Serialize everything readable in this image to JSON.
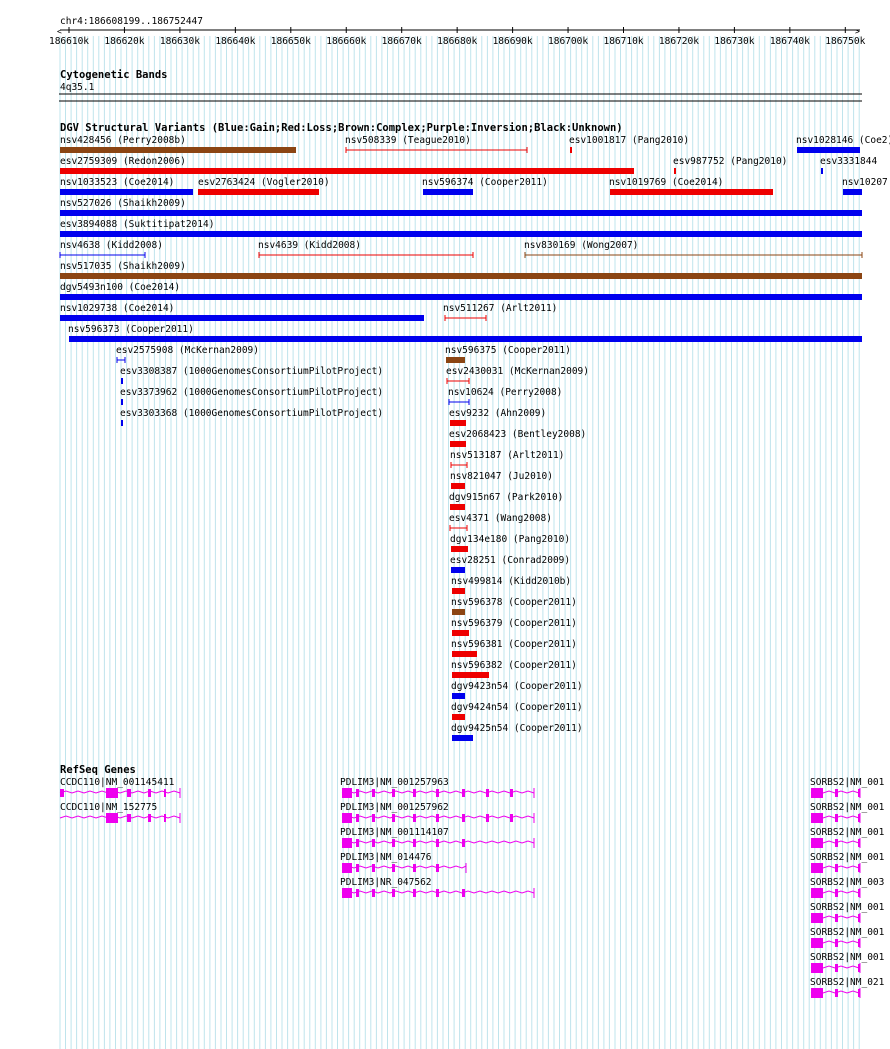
{
  "position_label": "chr4:186608199..186752447",
  "ruler": {
    "ticks": [
      "186610k",
      "186620k",
      "186630k",
      "186640k",
      "186650k",
      "186660k",
      "186670k",
      "186680k",
      "186690k",
      "186700k",
      "186710k",
      "186720k",
      "186730k",
      "186740k",
      "186750k"
    ]
  },
  "cyto": {
    "title": "Cytogenetic Bands",
    "band": "4q35.1"
  },
  "dgv": {
    "title": "DGV Structural Variants (Blue:Gain;Red:Loss;Brown:Complex;Purple:Inversion;Black:Unknown)",
    "colors": {
      "gain": "#0000ee",
      "loss": "#ee0000",
      "complex": "#8b4513"
    },
    "items": [
      {
        "id": "nsv428456",
        "study": "Perry2008b",
        "type": "complex"
      },
      {
        "id": "nsv508339",
        "study": "Teague2010",
        "type": "loss"
      },
      {
        "id": "esv1001817",
        "study": "Pang2010",
        "type": "loss"
      },
      {
        "id": "nsv1028146",
        "study": "Coe2",
        "type": "gain"
      },
      {
        "id": "esv2759309",
        "study": "Redon2006",
        "type": "loss"
      },
      {
        "id": "esv987752",
        "study": "Pang2010",
        "type": "loss"
      },
      {
        "id": "esv3331844",
        "study": "",
        "type": "gain"
      },
      {
        "id": "nsv1033523",
        "study": "Coe2014",
        "type": "gain"
      },
      {
        "id": "esv2763424",
        "study": "Vogler2010",
        "type": "loss"
      },
      {
        "id": "nsv596374",
        "study": "Cooper2011",
        "type": "gain"
      },
      {
        "id": "nsv1019769",
        "study": "Coe2014",
        "type": "loss"
      },
      {
        "id": "nsv10207",
        "study": "",
        "type": "gain"
      },
      {
        "id": "nsv527026",
        "study": "Shaikh2009",
        "type": "gain"
      },
      {
        "id": "esv3894088",
        "study": "Suktitipat2014",
        "type": "gain"
      },
      {
        "id": "nsv4638",
        "study": "Kidd2008",
        "type": "gain"
      },
      {
        "id": "nsv4639",
        "study": "Kidd2008",
        "type": "loss"
      },
      {
        "id": "nsv830169",
        "study": "Wong2007",
        "type": "complex"
      },
      {
        "id": "nsv517035",
        "study": "Shaikh2009",
        "type": "complex"
      },
      {
        "id": "dgv5493n100",
        "study": "Coe2014",
        "type": "gain"
      },
      {
        "id": "nsv1029738",
        "study": "Coe2014",
        "type": "gain"
      },
      {
        "id": "nsv511267",
        "study": "Arlt2011",
        "type": "loss"
      },
      {
        "id": "nsv596373",
        "study": "Cooper2011",
        "type": "gain"
      },
      {
        "id": "esv2575908",
        "study": "McKernan2009",
        "type": "gain"
      },
      {
        "id": "nsv596375",
        "study": "Cooper2011",
        "type": "complex"
      },
      {
        "id": "esv3308387",
        "study": "1000GenomesConsortiumPilotProject",
        "type": "gain"
      },
      {
        "id": "esv2430031",
        "study": "McKernan2009",
        "type": "loss"
      },
      {
        "id": "esv3373962",
        "study": "1000GenomesConsortiumPilotProject",
        "type": "gain"
      },
      {
        "id": "nsv10624",
        "study": "Perry2008",
        "type": "gain"
      },
      {
        "id": "esv3303368",
        "study": "1000GenomesConsortiumPilotProject",
        "type": "gain"
      },
      {
        "id": "esv9232",
        "study": "Ahn2009",
        "type": "loss"
      },
      {
        "id": "esv2068423",
        "study": "Bentley2008",
        "type": "loss"
      },
      {
        "id": "nsv513187",
        "study": "Arlt2011",
        "type": "loss"
      },
      {
        "id": "nsv821047",
        "study": "Ju2010",
        "type": "loss"
      },
      {
        "id": "dgv915n67",
        "study": "Park2010",
        "type": "loss"
      },
      {
        "id": "esv4371",
        "study": "Wang2008",
        "type": "loss"
      },
      {
        "id": "dgv134e180",
        "study": "Pang2010",
        "type": "loss"
      },
      {
        "id": "esv28251",
        "study": "Conrad2009",
        "type": "gain"
      },
      {
        "id": "nsv499814",
        "study": "Kidd2010b",
        "type": "loss"
      },
      {
        "id": "nsv596378",
        "study": "Cooper2011",
        "type": "complex"
      },
      {
        "id": "nsv596379",
        "study": "Cooper2011",
        "type": "loss"
      },
      {
        "id": "nsv596381",
        "study": "Cooper2011",
        "type": "loss"
      },
      {
        "id": "nsv596382",
        "study": "Cooper2011",
        "type": "loss"
      },
      {
        "id": "dgv9423n54",
        "study": "Cooper2011",
        "type": "gain"
      },
      {
        "id": "dgv9424n54",
        "study": "Cooper2011",
        "type": "loss"
      },
      {
        "id": "dgv9425n54",
        "study": "Cooper2011",
        "type": "gain"
      }
    ]
  },
  "refseq": {
    "title": "RefSeq Genes",
    "color": "#ee00ee",
    "genes": [
      {
        "label": "CCDC110|NM_001145411"
      },
      {
        "label": "CCDC110|NM_152775"
      },
      {
        "label": "PDLIM3|NM_001257963"
      },
      {
        "label": "PDLIM3|NM_001257962"
      },
      {
        "label": "PDLIM3|NM_001114107"
      },
      {
        "label": "PDLIM3|NM_014476"
      },
      {
        "label": "PDLIM3|NR_047562"
      },
      {
        "label": "SORBS2|NM_001"
      },
      {
        "label": "SORBS2|NM_001"
      },
      {
        "label": "SORBS2|NM_001"
      },
      {
        "label": "SORBS2|NM_001"
      },
      {
        "label": "SORBS2|NM_003"
      },
      {
        "label": "SORBS2|NM_001"
      },
      {
        "label": "SORBS2|NM_001"
      },
      {
        "label": "SORBS2|NM_001"
      },
      {
        "label": "SORBS2|NM_021"
      }
    ]
  }
}
